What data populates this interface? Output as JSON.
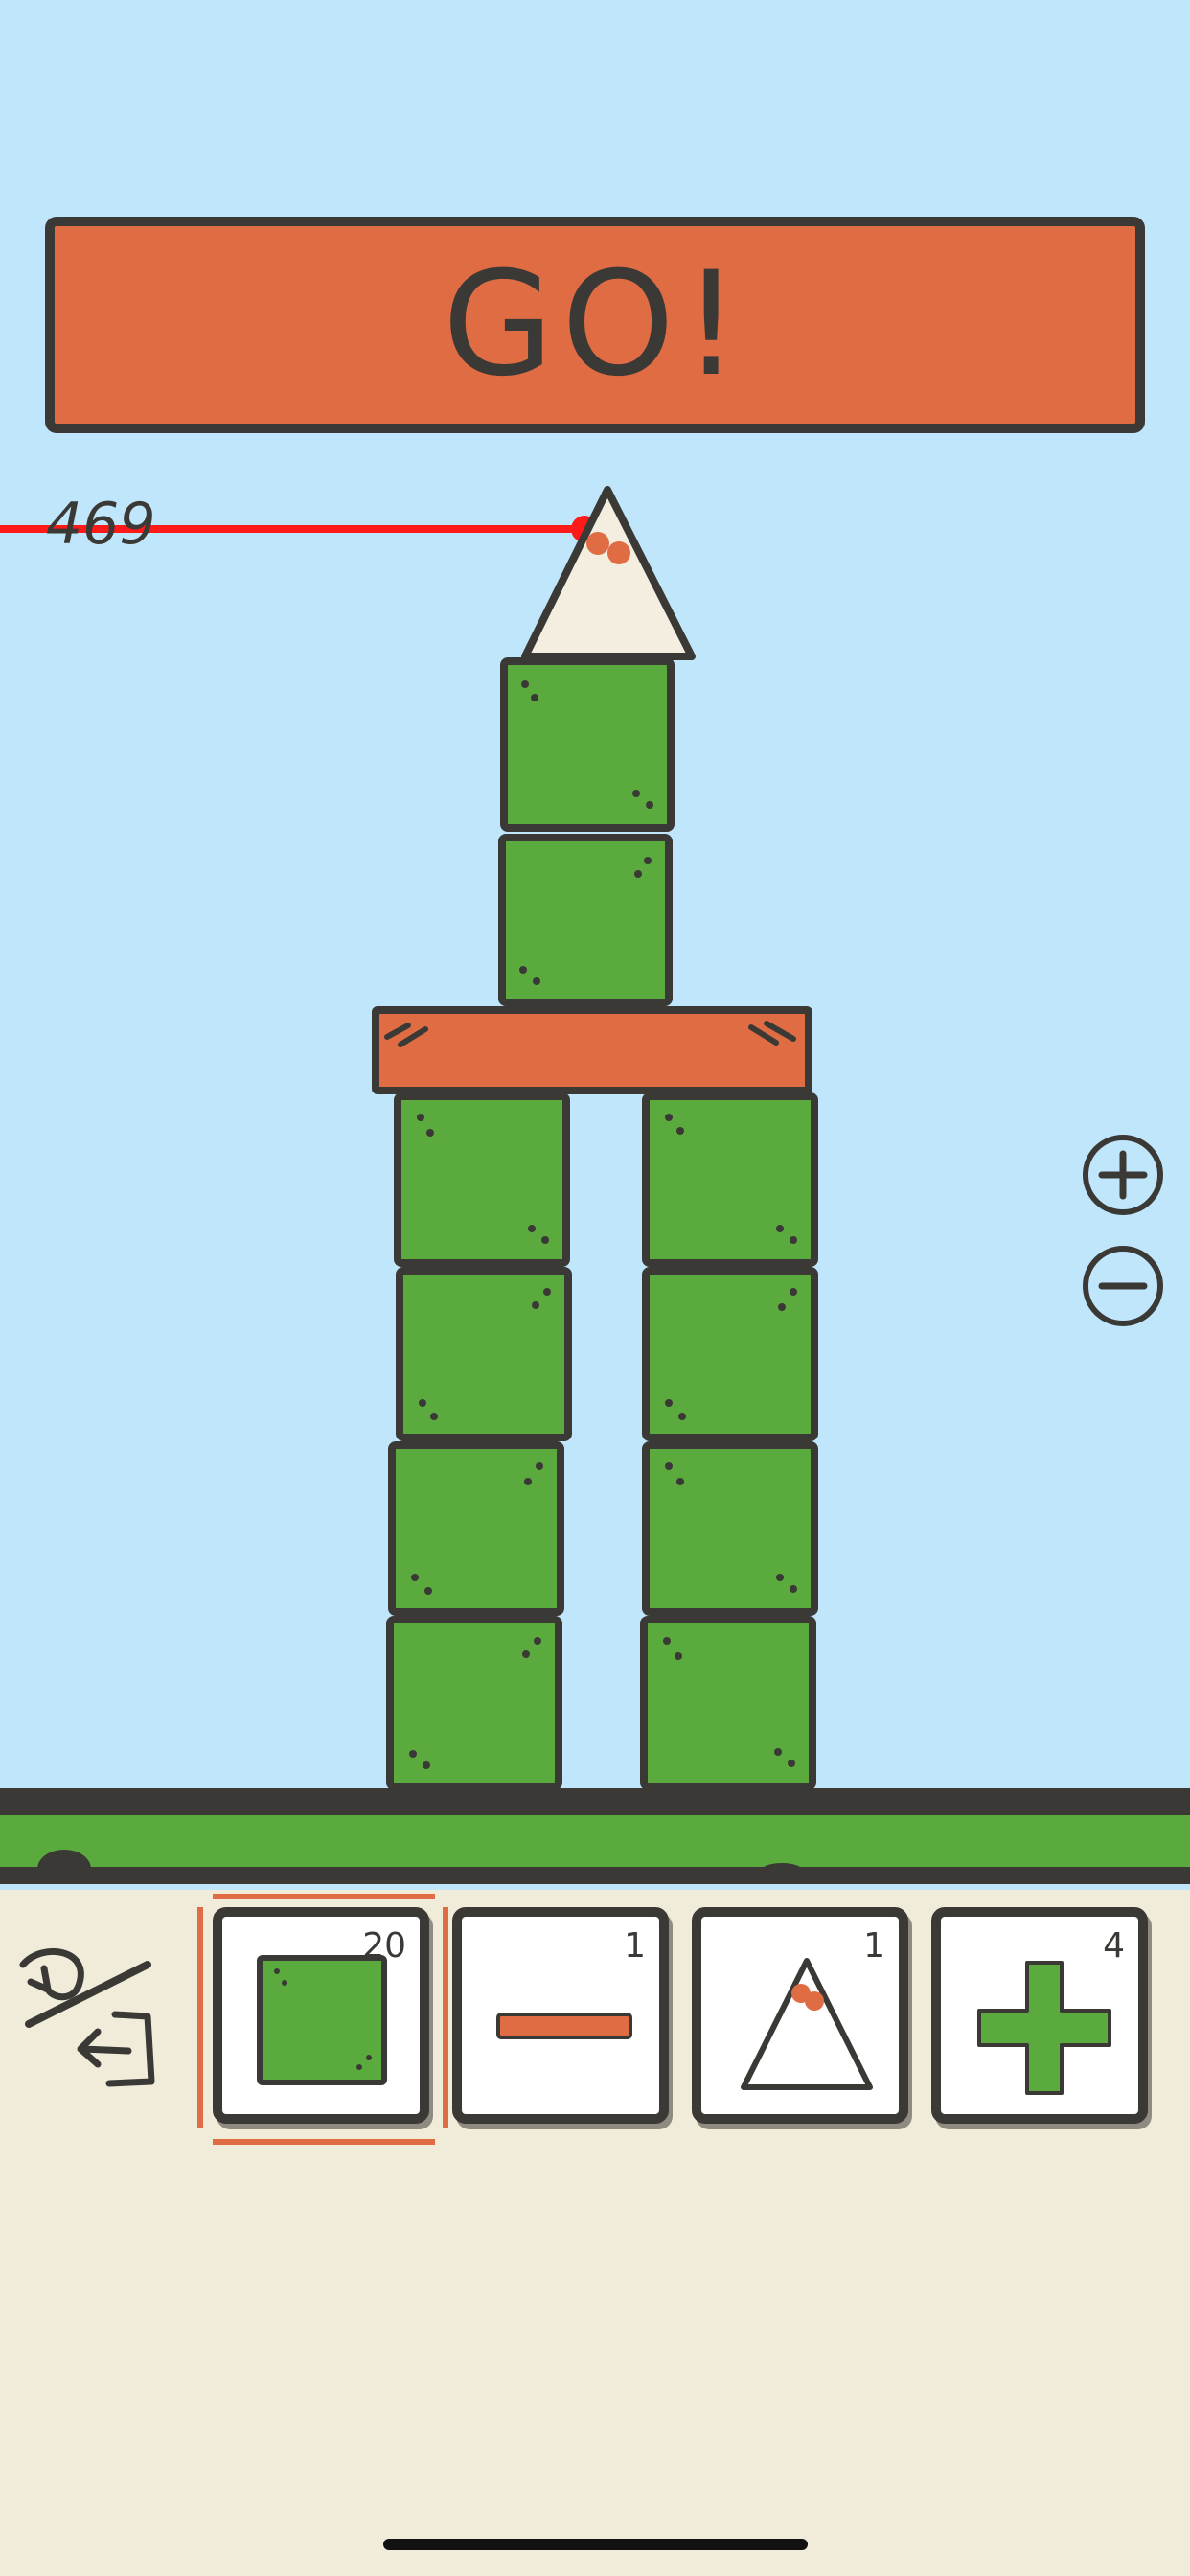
{
  "banner": {
    "label": "GO!"
  },
  "height_marker": {
    "value": "469"
  },
  "zoom": {
    "in_icon": "plus-circle-icon",
    "out_icon": "minus-circle-icon"
  },
  "toolbar": {
    "undo_redo_icon": "undo-redo-icon"
  },
  "inventory": [
    {
      "piece": "square-block",
      "count": "20",
      "selected": true
    },
    {
      "piece": "plank",
      "count": "1",
      "selected": false
    },
    {
      "piece": "triangle",
      "count": "1",
      "selected": false
    },
    {
      "piece": "cross",
      "count": "4",
      "selected": false
    }
  ],
  "colors": {
    "sky": "#bfe6fb",
    "banner": "#e06c43",
    "block_green": "#5aaa3e",
    "outline": "#3b3936",
    "height_line": "#ff1a1a",
    "tray": "#f1ecda"
  }
}
